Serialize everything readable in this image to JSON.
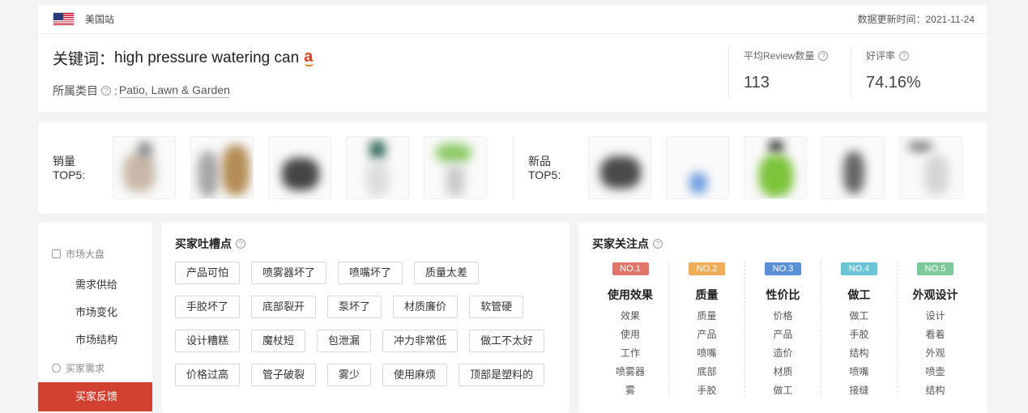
{
  "header": {
    "site_name": "美国站",
    "update_label": "数据更新时间：2021-11-24",
    "keyword_prefix": "关键词：",
    "keyword": "high pressure watering can",
    "amazon_logo": "a",
    "category_label": "所属类目",
    "category_sep": ":",
    "category_value": "Patio, Lawn & Garden",
    "help_glyph": "?"
  },
  "stats": [
    {
      "label": "平均Review数量",
      "value": "113"
    },
    {
      "label": "好评率",
      "value": "74.16%"
    }
  ],
  "top5": {
    "sales_label_1": "销量",
    "sales_label_2": "TOP5:",
    "new_label_1": "新品",
    "new_label_2": "TOP5:"
  },
  "sidebar": {
    "groups": [
      {
        "label": "市场大盘",
        "icon": "chart-icon"
      },
      {
        "label": "买家需求",
        "icon": "chat-icon"
      }
    ],
    "items": [
      "需求供给",
      "市场变化",
      "市场结构",
      "买家反馈"
    ],
    "active_item": "买家反馈",
    "active_color": "#d2402f"
  },
  "complaints": {
    "title": "买家吐槽点",
    "rows": [
      [
        "产品可怕",
        "喷雾器坏了",
        "喷嘴坏了",
        "质量太差"
      ],
      [
        "手胶坏了",
        "底部裂开",
        "泵坏了",
        "材质廉价",
        "软管硬"
      ],
      [
        "设计糟糕",
        "魔杖短",
        "包泄漏",
        "冲力非常低",
        "做工不太好"
      ],
      [
        "价格过高",
        "管子破裂",
        "雾少",
        "使用麻烦",
        "顶部是塑料的"
      ]
    ]
  },
  "focus": {
    "title": "买家关注点",
    "columns": [
      {
        "badge": "NO.1",
        "color": "#e0766a",
        "title": "使用效果",
        "words": [
          "效果",
          "使用",
          "工作",
          "喷雾器",
          "雾"
        ]
      },
      {
        "badge": "NO.2",
        "color": "#f0ad57",
        "title": "质量",
        "words": [
          "质量",
          "产品",
          "喷嘴",
          "底部",
          "手胶"
        ]
      },
      {
        "badge": "NO.3",
        "color": "#5b8fd6",
        "title": "性价比",
        "words": [
          "价格",
          "产品",
          "造价",
          "材质",
          "做工"
        ]
      },
      {
        "badge": "NO.4",
        "color": "#6cc3d5",
        "title": "做工",
        "words": [
          "做工",
          "手胶",
          "结构",
          "喷嘴",
          "接缝"
        ]
      },
      {
        "badge": "NO.5",
        "color": "#7ec99a",
        "title": "外观设计",
        "words": [
          "设计",
          "看着",
          "外观",
          "喷壶",
          "结构"
        ]
      }
    ]
  }
}
